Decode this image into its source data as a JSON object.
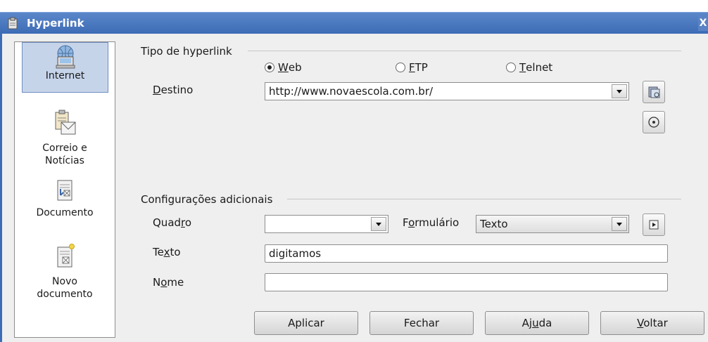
{
  "window": {
    "title": "Hyperlink",
    "close_glyph": "X"
  },
  "sidebar": {
    "items": [
      {
        "label": "Internet",
        "icon": "internet-globe-icon"
      },
      {
        "label": "Correio e\nNotícias",
        "icon": "mail-news-icon"
      },
      {
        "label": "Documento",
        "icon": "document-icon"
      },
      {
        "label": "Novo\ndocumento",
        "icon": "new-document-icon"
      }
    ]
  },
  "hyperlink_type": {
    "group_label": "Tipo de hyperlink",
    "options": [
      {
        "label_u": "W",
        "label_rest": "eb",
        "checked": true
      },
      {
        "label_u": "F",
        "label_rest": "TP",
        "checked": false
      },
      {
        "label_u": "T",
        "label_rest": "elnet",
        "checked": false
      }
    ],
    "destination_label_u": "D",
    "destination_label_rest": "estino",
    "destination_value": "http://www.novaescola.com.br/"
  },
  "additional": {
    "group_label": "Configurações adicionais",
    "frame_label_pre": "Quad",
    "frame_label_u": "r",
    "frame_label_post": "o",
    "frame_value": "",
    "form_label_pre": "F",
    "form_label_u": "o",
    "form_label_post": "rmulário",
    "form_value": "Texto",
    "text_label_pre": "Te",
    "text_label_u": "x",
    "text_label_post": "to",
    "text_value": "digitamos",
    "name_label_pre": "N",
    "name_label_u": "o",
    "name_label_post": "me",
    "name_value": ""
  },
  "buttons": {
    "apply": "Aplicar",
    "close": "Fechar",
    "help_pre": "Aj",
    "help_u": "u",
    "help_post": "da",
    "back_u": "V",
    "back_post": "oltar"
  }
}
